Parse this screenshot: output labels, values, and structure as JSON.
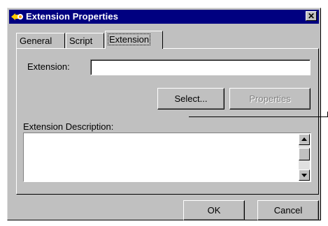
{
  "window": {
    "title": "Extension Properties",
    "close_label": "✕"
  },
  "tabs": [
    {
      "label": "General"
    },
    {
      "label": "Script"
    },
    {
      "label": "Extension"
    }
  ],
  "active_tab": "Extension",
  "extension": {
    "label": "Extension:",
    "value": "",
    "select_label": "Select...",
    "properties_label": "Properties",
    "properties_enabled": false,
    "description_label": "Extension Description:",
    "description_value": ""
  },
  "footer": {
    "ok_label": "OK",
    "cancel_label": "Cancel"
  },
  "colors": {
    "titlebar": "#000080",
    "face": "#c0c0c0"
  }
}
